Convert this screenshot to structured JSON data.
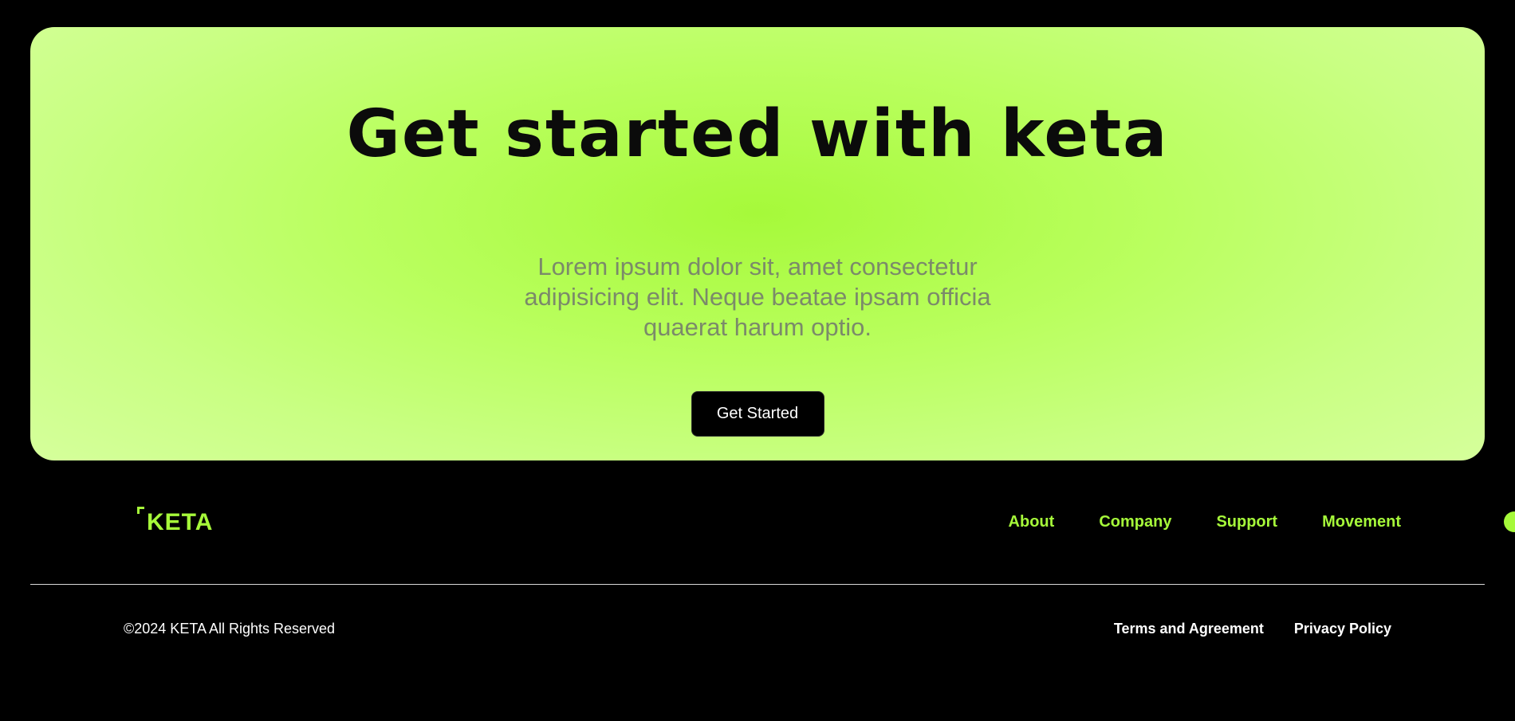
{
  "cta": {
    "title": "Get started with keta",
    "description": "Lorem ipsum dolor sit, amet consectetur adipisicing elit. Neque beatae ipsam officia quaerat harum optio.",
    "button_label": "Get Started"
  },
  "footer": {
    "logo_text": "KETA",
    "nav": [
      {
        "label": "About"
      },
      {
        "label": "Company"
      },
      {
        "label": "Support"
      },
      {
        "label": "Movement"
      }
    ],
    "copyright": "©2024 KETA All Rights Reserved",
    "legal_links": [
      {
        "label": "Terms and Agreement"
      },
      {
        "label": "Privacy Policy"
      }
    ]
  },
  "colors": {
    "background": "#000000",
    "accent": "#a6f93a",
    "cta_gradient_center": "#a6f93a",
    "cta_gradient_edge": "#d6ff9d",
    "body_text_muted": "#7b8a6a",
    "white": "#ffffff"
  },
  "icons": {
    "logo_mark": "corner-bracket-icon",
    "edge_indicator": "green-dot-icon"
  }
}
